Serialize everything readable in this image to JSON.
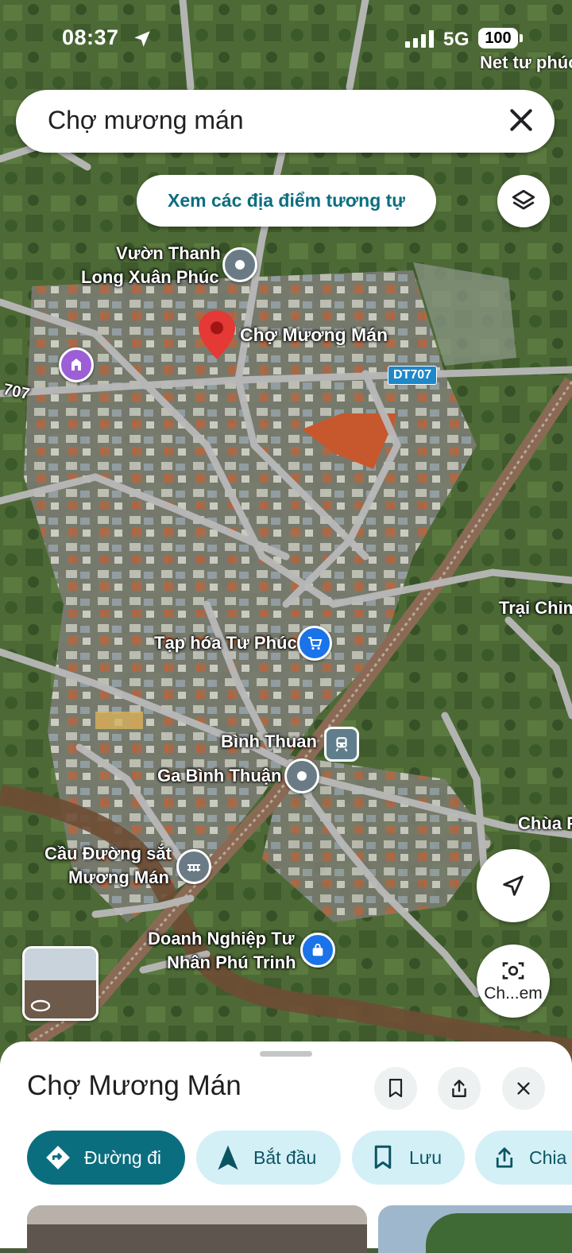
{
  "status_bar": {
    "time": "08:37",
    "network": "5G",
    "battery": "100",
    "carrier_label": "Net tư phúc"
  },
  "search": {
    "query": "Chợ mương mán"
  },
  "similar_chip": {
    "label": "Xem các địa điểm tương tự"
  },
  "map": {
    "labels": {
      "vuon_thanh_1": "Vườn Thanh",
      "vuon_thanh_2": "Long Xuân Phúc",
      "cho_muong_man": "Chợ Mương Mán",
      "dt707_shield": "DT707",
      "road_707": "707",
      "trai_chim": "Trại Chim",
      "tap_hoa": "Tạp hóa Tư Phúc",
      "binh_thuan": "Bình Thuan",
      "ga_binh_thuan": "Ga Bình Thuận",
      "chua": "Chùa P",
      "cau_1": "Cầu Đường sắt",
      "cau_2": "Mương Mán",
      "dn_1": "Doanh Nghiệp Tư",
      "dn_2": "Nhân Phú Trinh"
    }
  },
  "streetview_button": {
    "label": "Ch...em"
  },
  "sheet": {
    "title": "Chợ Mương Mán",
    "actions": {
      "directions": "Đường đi",
      "start": "Bắt đầu",
      "save": "Lưu",
      "share": "Chia"
    }
  },
  "colors": {
    "accent": "#0b6e7f",
    "chip_bg": "#d4f0f7",
    "pin_red": "#e53935",
    "shop_blue": "#1a73e8",
    "landmark_purple": "#9c5fd6"
  }
}
